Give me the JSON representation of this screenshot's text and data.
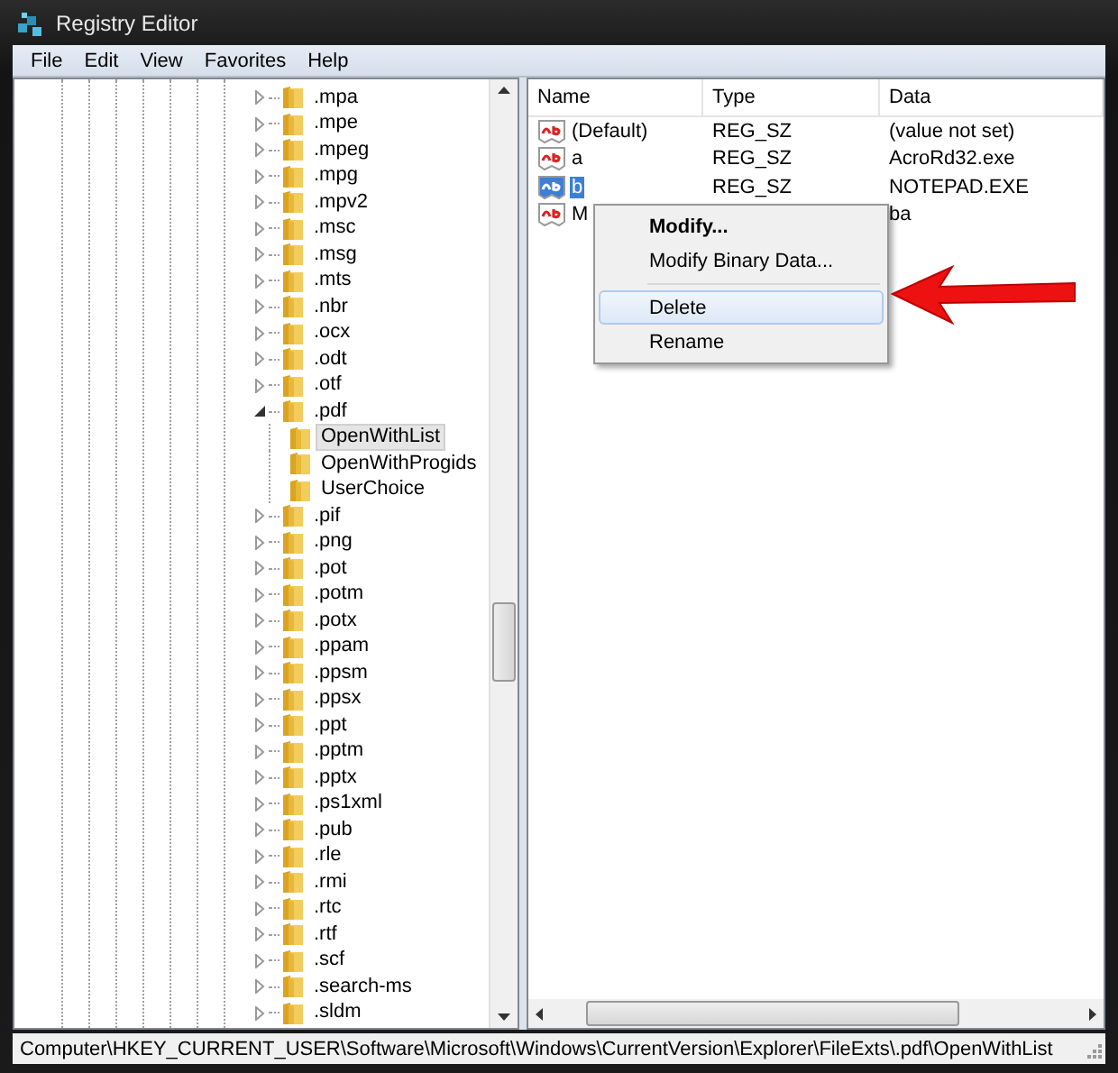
{
  "window": {
    "title": "Registry Editor"
  },
  "menu_bar": [
    "File",
    "Edit",
    "View",
    "Favorites",
    "Help"
  ],
  "tree": [
    {
      "label": ".mpa",
      "expanded": false,
      "selected": false
    },
    {
      "label": ".mpe",
      "expanded": false,
      "selected": false
    },
    {
      "label": ".mpeg",
      "expanded": false,
      "selected": false
    },
    {
      "label": ".mpg",
      "expanded": false,
      "selected": false
    },
    {
      "label": ".mpv2",
      "expanded": false,
      "selected": false
    },
    {
      "label": ".msc",
      "expanded": false,
      "selected": false
    },
    {
      "label": ".msg",
      "expanded": false,
      "selected": false
    },
    {
      "label": ".mts",
      "expanded": false,
      "selected": false
    },
    {
      "label": ".nbr",
      "expanded": false,
      "selected": false
    },
    {
      "label": ".ocx",
      "expanded": false,
      "selected": false
    },
    {
      "label": ".odt",
      "expanded": false,
      "selected": false
    },
    {
      "label": ".otf",
      "expanded": false,
      "selected": false
    },
    {
      "label": ".pdf",
      "expanded": true,
      "selected": false,
      "children": [
        {
          "label": "OpenWithList",
          "selected": true
        },
        {
          "label": "OpenWithProgids",
          "selected": false
        },
        {
          "label": "UserChoice",
          "selected": false
        }
      ]
    },
    {
      "label": ".pif",
      "expanded": false,
      "selected": false
    },
    {
      "label": ".png",
      "expanded": false,
      "selected": false
    },
    {
      "label": ".pot",
      "expanded": false,
      "selected": false
    },
    {
      "label": ".potm",
      "expanded": false,
      "selected": false
    },
    {
      "label": ".potx",
      "expanded": false,
      "selected": false
    },
    {
      "label": ".ppam",
      "expanded": false,
      "selected": false
    },
    {
      "label": ".ppsm",
      "expanded": false,
      "selected": false
    },
    {
      "label": ".ppsx",
      "expanded": false,
      "selected": false
    },
    {
      "label": ".ppt",
      "expanded": false,
      "selected": false
    },
    {
      "label": ".pptm",
      "expanded": false,
      "selected": false
    },
    {
      "label": ".pptx",
      "expanded": false,
      "selected": false
    },
    {
      "label": ".ps1xml",
      "expanded": false,
      "selected": false
    },
    {
      "label": ".pub",
      "expanded": false,
      "selected": false
    },
    {
      "label": ".rle",
      "expanded": false,
      "selected": false
    },
    {
      "label": ".rmi",
      "expanded": false,
      "selected": false
    },
    {
      "label": ".rtc",
      "expanded": false,
      "selected": false
    },
    {
      "label": ".rtf",
      "expanded": false,
      "selected": false
    },
    {
      "label": ".scf",
      "expanded": false,
      "selected": false
    },
    {
      "label": ".search-ms",
      "expanded": false,
      "selected": false
    },
    {
      "label": ".sldm",
      "expanded": false,
      "selected": false
    }
  ],
  "values_table": {
    "columns": [
      "Name",
      "Type",
      "Data"
    ],
    "rows": [
      {
        "name": "(Default)",
        "type": "REG_SZ",
        "data": "(value not set)",
        "selected": false
      },
      {
        "name": "a",
        "type": "REG_SZ",
        "data": "AcroRd32.exe",
        "selected": false
      },
      {
        "name": "b",
        "type": "REG_SZ",
        "data": "NOTEPAD.EXE",
        "selected": true
      },
      {
        "name": "M",
        "data": "ba",
        "selected": false
      }
    ]
  },
  "context_menu": [
    {
      "kind": "item",
      "label": "Modify...",
      "bold": true,
      "highlighted": false
    },
    {
      "kind": "item",
      "label": "Modify Binary Data...",
      "bold": false,
      "highlighted": false
    },
    {
      "kind": "separator"
    },
    {
      "kind": "item",
      "label": "Delete",
      "bold": false,
      "highlighted": true
    },
    {
      "kind": "item",
      "label": "Rename",
      "bold": false,
      "highlighted": false
    }
  ],
  "status_bar": "Computer\\HKEY_CURRENT_USER\\Software\\Microsoft\\Windows\\CurrentVersion\\Explorer\\FileExts\\.pdf\\OpenWithList"
}
